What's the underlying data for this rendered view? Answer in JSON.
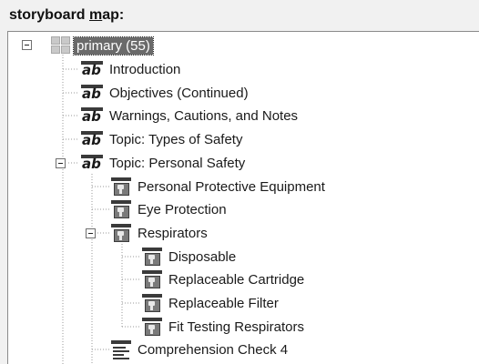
{
  "panel": {
    "label_prefix": "storyboard ",
    "label_mnemonic": "m",
    "label_suffix": "ap:"
  },
  "tree": {
    "root": {
      "label": "primary (55)",
      "icon": "grid-icon",
      "expanded": true,
      "selected": true
    },
    "items": [
      {
        "label": "Introduction",
        "icon": "text-ab-icon"
      },
      {
        "label": "Objectives (Continued)",
        "icon": "text-ab-icon"
      },
      {
        "label": "Warnings, Cautions, and Notes",
        "icon": "text-ab-icon"
      },
      {
        "label": "Topic: Types of Safety",
        "icon": "text-ab-icon"
      },
      {
        "label": "Topic: Personal Safety",
        "icon": "text-ab-icon",
        "expanded": true
      },
      {
        "label": "Personal Protective Equipment",
        "icon": "knowledge-object-icon"
      },
      {
        "label": "Eye Protection",
        "icon": "knowledge-object-icon"
      },
      {
        "label": "Respirators",
        "icon": "knowledge-object-icon",
        "expanded": true
      },
      {
        "label": "Disposable",
        "icon": "knowledge-object-icon"
      },
      {
        "label": "Replaceable Cartridge",
        "icon": "knowledge-object-icon"
      },
      {
        "label": "Replaceable Filter",
        "icon": "knowledge-object-icon"
      },
      {
        "label": "Fit Testing Respirators",
        "icon": "knowledge-object-icon"
      },
      {
        "label": "Comprehension Check 4",
        "icon": "comprehension-check-icon"
      }
    ]
  }
}
